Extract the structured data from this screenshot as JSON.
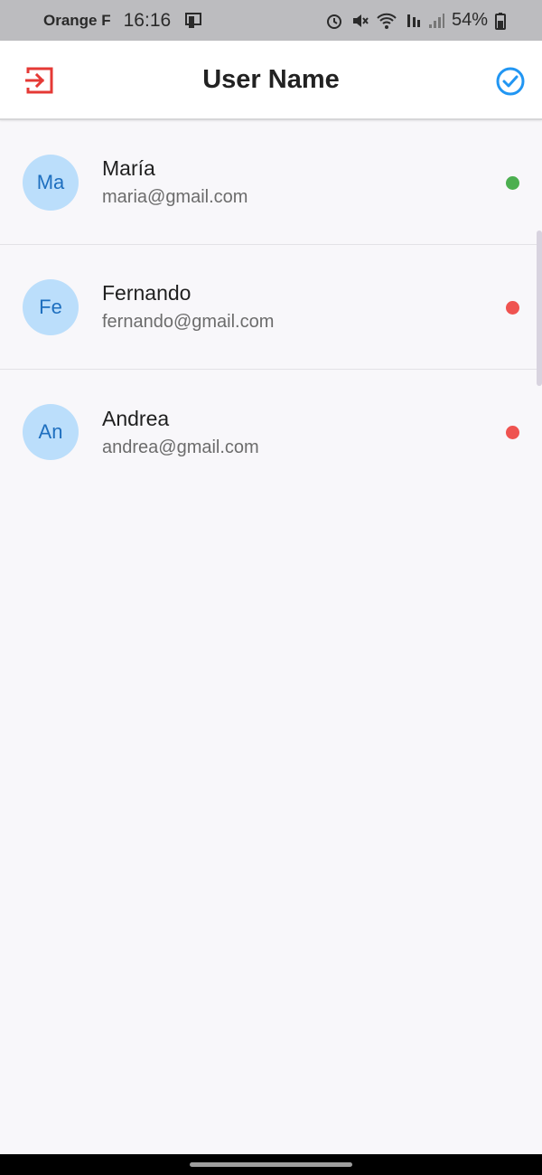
{
  "status_bar": {
    "carrier": "Orange F",
    "time": "16:16",
    "battery_percent": "54%",
    "icons": [
      "cast-icon",
      "alarm-icon",
      "mute-icon",
      "wifi-icon",
      "mobile-data-icon",
      "signal-icon",
      "battery-icon"
    ]
  },
  "app_bar": {
    "title": "User Name",
    "logout_icon_color": "#e53935",
    "check_icon_color": "#2196f3"
  },
  "users": [
    {
      "initials": "Ma",
      "name": "María",
      "email": "maria@gmail.com",
      "online": true
    },
    {
      "initials": "Fe",
      "name": "Fernando",
      "email": "fernando@gmail.com",
      "online": false
    },
    {
      "initials": "An",
      "name": "Andrea",
      "email": "andrea@gmail.com",
      "online": false
    }
  ],
  "colors": {
    "online": "#4caf50",
    "offline": "#ef5350",
    "avatar_bg": "#bbdefb",
    "avatar_text": "#1e6fbf",
    "background": "#f8f7fa"
  }
}
